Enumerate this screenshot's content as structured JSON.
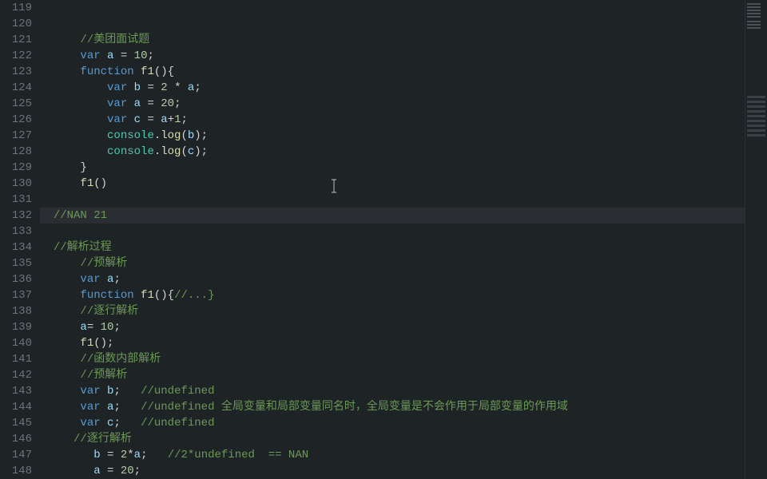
{
  "lineStart": 119,
  "highlightLine": 132,
  "cursor": {
    "line": 130,
    "col": 46
  },
  "lines": [
    {
      "n": 119,
      "tokens": []
    },
    {
      "n": 120,
      "tokens": []
    },
    {
      "n": 121,
      "tokens": [
        {
          "cls": "t-plain",
          "text": "    "
        },
        {
          "cls": "t-comment-cn",
          "text": "//美团面试题"
        }
      ]
    },
    {
      "n": 122,
      "tokens": [
        {
          "cls": "t-plain",
          "text": "    "
        },
        {
          "cls": "t-keyword",
          "text": "var"
        },
        {
          "cls": "t-plain",
          "text": " "
        },
        {
          "cls": "t-var",
          "text": "a"
        },
        {
          "cls": "t-plain",
          "text": " = "
        },
        {
          "cls": "t-number",
          "text": "10"
        },
        {
          "cls": "t-punc",
          "text": ";"
        }
      ]
    },
    {
      "n": 123,
      "tokens": [
        {
          "cls": "t-plain",
          "text": "    "
        },
        {
          "cls": "t-keyword",
          "text": "function"
        },
        {
          "cls": "t-plain",
          "text": " "
        },
        {
          "cls": "t-fname",
          "text": "f1"
        },
        {
          "cls": "t-punc",
          "text": "(){"
        }
      ]
    },
    {
      "n": 124,
      "tokens": [
        {
          "cls": "t-plain",
          "text": "        "
        },
        {
          "cls": "t-keyword",
          "text": "var"
        },
        {
          "cls": "t-plain",
          "text": " "
        },
        {
          "cls": "t-var",
          "text": "b"
        },
        {
          "cls": "t-plain",
          "text": " = "
        },
        {
          "cls": "t-number",
          "text": "2"
        },
        {
          "cls": "t-plain",
          "text": " * "
        },
        {
          "cls": "t-var",
          "text": "a"
        },
        {
          "cls": "t-punc",
          "text": ";"
        }
      ]
    },
    {
      "n": 125,
      "tokens": [
        {
          "cls": "t-plain",
          "text": "        "
        },
        {
          "cls": "t-keyword",
          "text": "var"
        },
        {
          "cls": "t-plain",
          "text": " "
        },
        {
          "cls": "t-var",
          "text": "a"
        },
        {
          "cls": "t-plain",
          "text": " = "
        },
        {
          "cls": "t-number",
          "text": "20"
        },
        {
          "cls": "t-punc",
          "text": ";"
        }
      ]
    },
    {
      "n": 126,
      "tokens": [
        {
          "cls": "t-plain",
          "text": "        "
        },
        {
          "cls": "t-keyword",
          "text": "var"
        },
        {
          "cls": "t-plain",
          "text": " "
        },
        {
          "cls": "t-var",
          "text": "c"
        },
        {
          "cls": "t-plain",
          "text": " = "
        },
        {
          "cls": "t-var",
          "text": "a"
        },
        {
          "cls": "t-plain",
          "text": "+"
        },
        {
          "cls": "t-number",
          "text": "1"
        },
        {
          "cls": "t-punc",
          "text": ";"
        }
      ]
    },
    {
      "n": 127,
      "tokens": [
        {
          "cls": "t-plain",
          "text": "        "
        },
        {
          "cls": "t-obj",
          "text": "console"
        },
        {
          "cls": "t-punc",
          "text": "."
        },
        {
          "cls": "t-fname",
          "text": "log"
        },
        {
          "cls": "t-punc",
          "text": "("
        },
        {
          "cls": "t-var",
          "text": "b"
        },
        {
          "cls": "t-punc",
          "text": ");"
        }
      ]
    },
    {
      "n": 128,
      "tokens": [
        {
          "cls": "t-plain",
          "text": "        "
        },
        {
          "cls": "t-obj",
          "text": "console"
        },
        {
          "cls": "t-punc",
          "text": "."
        },
        {
          "cls": "t-fname",
          "text": "log"
        },
        {
          "cls": "t-punc",
          "text": "("
        },
        {
          "cls": "t-var",
          "text": "c"
        },
        {
          "cls": "t-punc",
          "text": ");"
        }
      ]
    },
    {
      "n": 129,
      "tokens": [
        {
          "cls": "t-plain",
          "text": "    "
        },
        {
          "cls": "t-punc",
          "text": "}"
        }
      ]
    },
    {
      "n": 130,
      "tokens": [
        {
          "cls": "t-plain",
          "text": "    "
        },
        {
          "cls": "t-fname",
          "text": "f1"
        },
        {
          "cls": "t-punc",
          "text": "()"
        }
      ]
    },
    {
      "n": 131,
      "tokens": []
    },
    {
      "n": 132,
      "tokens": [
        {
          "cls": "t-comment",
          "text": "//NAN 21"
        }
      ]
    },
    {
      "n": 133,
      "tokens": []
    },
    {
      "n": 134,
      "tokens": [
        {
          "cls": "t-comment-cn",
          "text": "//解析过程"
        }
      ]
    },
    {
      "n": 135,
      "tokens": [
        {
          "cls": "t-plain",
          "text": "    "
        },
        {
          "cls": "t-comment-cn",
          "text": "//预解析"
        }
      ]
    },
    {
      "n": 136,
      "tokens": [
        {
          "cls": "t-plain",
          "text": "    "
        },
        {
          "cls": "t-keyword",
          "text": "var"
        },
        {
          "cls": "t-plain",
          "text": " "
        },
        {
          "cls": "t-var",
          "text": "a"
        },
        {
          "cls": "t-punc",
          "text": ";"
        }
      ]
    },
    {
      "n": 137,
      "tokens": [
        {
          "cls": "t-plain",
          "text": "    "
        },
        {
          "cls": "t-keyword",
          "text": "function"
        },
        {
          "cls": "t-plain",
          "text": " "
        },
        {
          "cls": "t-fname",
          "text": "f1"
        },
        {
          "cls": "t-punc",
          "text": "(){"
        },
        {
          "cls": "t-comment",
          "text": "//...}"
        }
      ]
    },
    {
      "n": 138,
      "tokens": [
        {
          "cls": "t-plain",
          "text": "    "
        },
        {
          "cls": "t-comment-cn",
          "text": "//逐行解析"
        }
      ]
    },
    {
      "n": 139,
      "tokens": [
        {
          "cls": "t-plain",
          "text": "    "
        },
        {
          "cls": "t-var",
          "text": "a"
        },
        {
          "cls": "t-plain",
          "text": "= "
        },
        {
          "cls": "t-number",
          "text": "10"
        },
        {
          "cls": "t-punc",
          "text": ";"
        }
      ]
    },
    {
      "n": 140,
      "tokens": [
        {
          "cls": "t-plain",
          "text": "    "
        },
        {
          "cls": "t-fname",
          "text": "f1"
        },
        {
          "cls": "t-punc",
          "text": "();"
        }
      ]
    },
    {
      "n": 141,
      "tokens": [
        {
          "cls": "t-plain",
          "text": "    "
        },
        {
          "cls": "t-comment-cn",
          "text": "//函数内部解析"
        }
      ]
    },
    {
      "n": 142,
      "tokens": [
        {
          "cls": "t-plain",
          "text": "    "
        },
        {
          "cls": "t-comment-cn",
          "text": "//预解析"
        }
      ]
    },
    {
      "n": 143,
      "tokens": [
        {
          "cls": "t-plain",
          "text": "    "
        },
        {
          "cls": "t-keyword",
          "text": "var"
        },
        {
          "cls": "t-plain",
          "text": " "
        },
        {
          "cls": "t-var",
          "text": "b"
        },
        {
          "cls": "t-punc",
          "text": ";   "
        },
        {
          "cls": "t-comment",
          "text": "//undefined"
        }
      ]
    },
    {
      "n": 144,
      "tokens": [
        {
          "cls": "t-plain",
          "text": "    "
        },
        {
          "cls": "t-keyword",
          "text": "var"
        },
        {
          "cls": "t-plain",
          "text": " "
        },
        {
          "cls": "t-var",
          "text": "a"
        },
        {
          "cls": "t-punc",
          "text": ";   "
        },
        {
          "cls": "t-comment",
          "text": "//undefined "
        },
        {
          "cls": "t-comment-cn",
          "text": "全局变量和局部变量同名时，全局变量是不会作用于局部变量的作用域"
        }
      ]
    },
    {
      "n": 145,
      "tokens": [
        {
          "cls": "t-plain",
          "text": "    "
        },
        {
          "cls": "t-keyword",
          "text": "var"
        },
        {
          "cls": "t-plain",
          "text": " "
        },
        {
          "cls": "t-var",
          "text": "c"
        },
        {
          "cls": "t-punc",
          "text": ";   "
        },
        {
          "cls": "t-comment",
          "text": "//undefined"
        }
      ]
    },
    {
      "n": 146,
      "tokens": [
        {
          "cls": "t-plain",
          "text": "   "
        },
        {
          "cls": "t-comment-cn",
          "text": "//逐行解析"
        }
      ]
    },
    {
      "n": 147,
      "tokens": [
        {
          "cls": "t-plain",
          "text": "      "
        },
        {
          "cls": "t-var",
          "text": "b"
        },
        {
          "cls": "t-plain",
          "text": " = "
        },
        {
          "cls": "t-number",
          "text": "2"
        },
        {
          "cls": "t-plain",
          "text": "*"
        },
        {
          "cls": "t-var",
          "text": "a"
        },
        {
          "cls": "t-punc",
          "text": ";   "
        },
        {
          "cls": "t-comment",
          "text": "//2*undefined  == NAN"
        }
      ]
    },
    {
      "n": 148,
      "tokens": [
        {
          "cls": "t-plain",
          "text": "      "
        },
        {
          "cls": "t-var",
          "text": "a"
        },
        {
          "cls": "t-plain",
          "text": " = "
        },
        {
          "cls": "t-number",
          "text": "20"
        },
        {
          "cls": "t-punc",
          "text": ";"
        }
      ]
    }
  ]
}
